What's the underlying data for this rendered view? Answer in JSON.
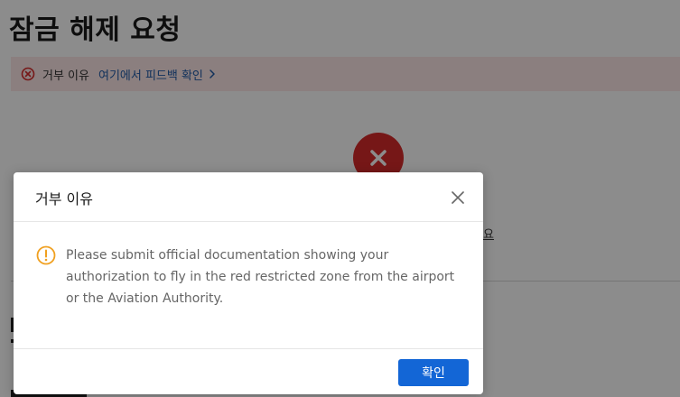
{
  "page": {
    "title": "잠금 해제 요청"
  },
  "banner": {
    "icon": "error-circle-icon",
    "label": "거부 이유",
    "link_text": "여기에서 피드백 확인",
    "link_icon": "chevron-right-icon",
    "color_bg": "#fde8e8",
    "color_link": "#1f5aa6",
    "color_icon": "#d82b2b"
  },
  "status": {
    "icon": "x-icon",
    "color": "#d82b2b"
  },
  "background": {
    "text_fragment": "요"
  },
  "modal": {
    "title": "거부 이유",
    "close_icon": "close-icon",
    "warning_icon": "warning-circle-icon",
    "warning_color": "#f0a020",
    "message": "Please submit official documentation showing your authorization to fly in the red restricted zone from the airport or the Aviation Authority.",
    "confirm_label": "확인",
    "confirm_color": "#1366d6"
  }
}
